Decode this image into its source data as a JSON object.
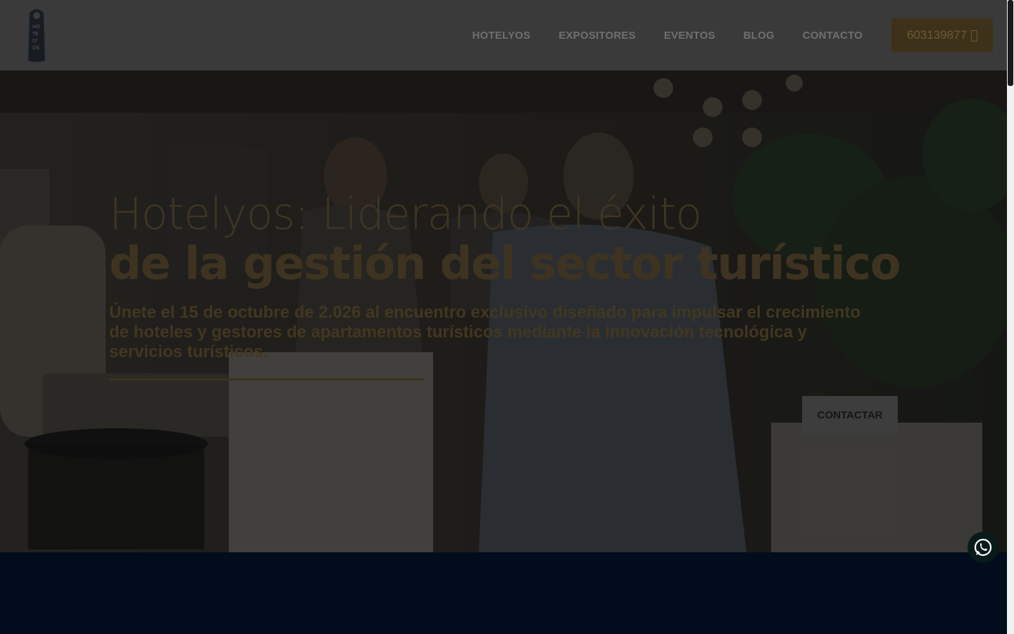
{
  "header": {
    "logo_icon": "hotelyos-door-hanger-logo",
    "nav": [
      {
        "label": "HOTELYOS"
      },
      {
        "label": "EXPOSITORES"
      },
      {
        "label": "EVENTOS"
      },
      {
        "label": "BLOG"
      },
      {
        "label": "CONTACTO"
      }
    ],
    "phone": {
      "label": "603139877",
      "icon": "phone-icon"
    }
  },
  "hero": {
    "title_light": "Hotelyos: Liderando el éxito",
    "title_bold": "de la gestión del sector turístico",
    "subtitle": "Únete el 15 de octubre de 2.026 al encuentro exclusivo diseñado para impulsar el crecimiento de hoteles y gestores de apartamentos turísticos mediante la innovación tecnológica y servicios turísticos.",
    "cta_label": "CONTACTAR"
  },
  "floating": {
    "whatsapp_icon": "whatsapp-icon"
  },
  "colors": {
    "header_bg": "#3a3a3a",
    "accent_gold": "#3e3320",
    "footer_bg": "#030c1c",
    "whatsapp_green": "#25d366"
  }
}
